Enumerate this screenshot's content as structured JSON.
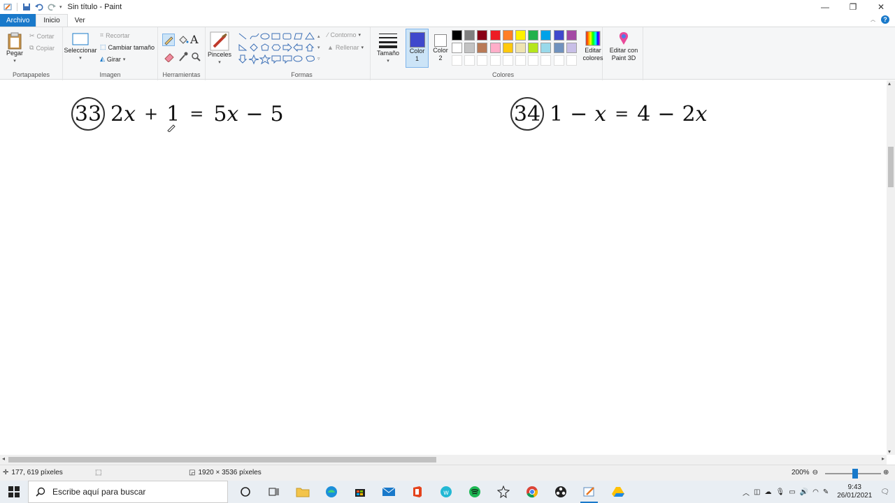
{
  "window": {
    "title": "Sin título - Paint",
    "controls": [
      "—",
      "❐",
      "✕"
    ]
  },
  "menu": {
    "tabs": [
      "Archivo",
      "Inicio",
      "Ver"
    ],
    "help_label": "?"
  },
  "ribbon": {
    "clipboard": {
      "group_label": "Portapapeles",
      "paste": "Pegar",
      "cut": "Cortar",
      "copy": "Copiar"
    },
    "image": {
      "group_label": "Imagen",
      "select": "Seleccionar",
      "crop": "Recortar",
      "resize": "Cambiar tamaño",
      "rotate": "Girar"
    },
    "tools": {
      "group_label": "Herramientas",
      "text": "A"
    },
    "brushes": {
      "label": "Pinceles"
    },
    "shapes": {
      "group_label": "Formas",
      "outline": "Contorno",
      "fill": "Rellenar"
    },
    "size": {
      "label": "Tamaño"
    },
    "colors": {
      "group_label": "Colores",
      "color1_label": "Color",
      "color1_num": "1",
      "color2_label": "Color",
      "color2_num": "2",
      "color1": "#3f48cc",
      "color2": "#ffffff",
      "edit_colors_1": "Editar",
      "edit_colors_2": "colores",
      "paint3d_1": "Editar con",
      "paint3d_2": "Paint 3D",
      "palette_row1": [
        "#000000",
        "#7f7f7f",
        "#880015",
        "#ed1c24",
        "#ff7f27",
        "#fff200",
        "#22b14c",
        "#00a2e8",
        "#3f48cc",
        "#a349a4"
      ],
      "palette_row2": [
        "#ffffff",
        "#c3c3c3",
        "#b97a57",
        "#ffaec9",
        "#ffc90e",
        "#efe4b0",
        "#b5e61d",
        "#99d9ea",
        "#7092be",
        "#c8bfe7"
      ]
    }
  },
  "canvas": {
    "eq1": {
      "number": "33",
      "lhs_a": "2",
      "lhs_var": "x",
      "lhs_op": "+",
      "lhs_b": "1",
      "eq": "=",
      "rhs_a": "5",
      "rhs_var": "x",
      "rhs_op": "−",
      "rhs_b": "5"
    },
    "eq2": {
      "number": "34",
      "lhs_a": "1",
      "lhs_op": "−",
      "lhs_var": "x",
      "eq": "=",
      "rhs_a": "4",
      "rhs_op": "−",
      "rhs_b": "2",
      "rhs_var": "x"
    }
  },
  "status": {
    "cursor_pos": "177, 619 píxeles",
    "image_size": "1920 × 3536 píxeles",
    "zoom": "200%"
  },
  "taskbar": {
    "search_placeholder": "Escribe aquí para buscar",
    "time": "9:43",
    "date": "26/01/2021"
  }
}
